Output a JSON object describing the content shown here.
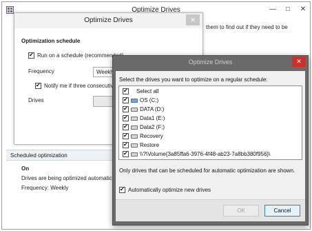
{
  "main_window": {
    "title": "Optimize Drives",
    "minimize": "—",
    "maximize": "□",
    "close": "✕",
    "hint_text": "them to find out if they need to be"
  },
  "scheduled": {
    "header": "Scheduled optimization",
    "state": "On",
    "line1": "Drives are being optimized automatical",
    "line2": "Frequency: Weekly"
  },
  "schedule_dialog": {
    "title": "Optimize Drives",
    "close": "✕",
    "heading": "Optimization schedule",
    "run_on_schedule": "Run on a schedule (recommended)",
    "frequency_label": "Frequency",
    "frequency_value": "Weekly",
    "notify_label": "Notify me if three consecutiv",
    "drives_label": "Drives"
  },
  "drive_dialog": {
    "title": "Optimize Drives",
    "close": "✕",
    "instruction": "Select the drives you want to optimize on a regular schedule:",
    "select_all": "Select all",
    "drives": [
      {
        "label": "OS (C:)",
        "icon": "system-drive-icon"
      },
      {
        "label": "DATA (D:)",
        "icon": "drive-icon"
      },
      {
        "label": "Data1 (E:)",
        "icon": "drive-icon"
      },
      {
        "label": "Data2 (F:)",
        "icon": "drive-icon"
      },
      {
        "label": "Recovery",
        "icon": "drive-icon"
      },
      {
        "label": "Restore",
        "icon": "drive-icon"
      },
      {
        "label": "\\\\?\\Volume{3a85ffa6-3976-4f48-ab23-7a8bb380f956}\\",
        "icon": "drive-icon"
      }
    ],
    "note": "Only drives that can be scheduled for automatic optimization are shown.",
    "auto_optimize": "Automatically optimize new drives",
    "ok": "OK",
    "cancel": "Cancel"
  },
  "colors": {
    "close_red": "#c8322c",
    "dialog_frame": "#6a6a6a",
    "drive_icon_fill": "#d6d6d6",
    "system_drive_fill": "#7aa7d6"
  }
}
